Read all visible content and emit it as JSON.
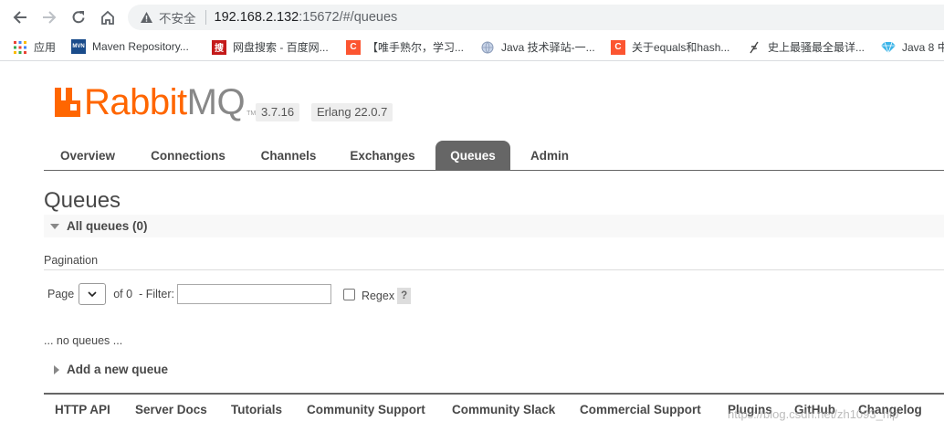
{
  "browser": {
    "insecure_label": "不安全",
    "url_host": "192.168.2.132",
    "url_path": ":15672/#/queues",
    "bookmarks": [
      {
        "label": "应用",
        "icon": "apps-grid-icon"
      },
      {
        "label": "Maven Repository...",
        "icon": "maven-icon"
      },
      {
        "label": "网盘搜索 - 百度网...",
        "icon": "sou-icon"
      },
      {
        "label": "【唯手熟尔，学习...",
        "icon": "csdn-icon"
      },
      {
        "label": "Java 技术驿站-一...",
        "icon": "globe-icon"
      },
      {
        "label": "关于equals和hash...",
        "icon": "csdn-icon"
      },
      {
        "label": "史上最骚最全最详...",
        "icon": "feather-icon"
      },
      {
        "label": "Java 8 中",
        "icon": "diamond-icon"
      }
    ]
  },
  "app": {
    "logo_main": "Rabbit",
    "logo_mq": "MQ",
    "logo_tm": "TM",
    "version": "3.7.16",
    "erlang": "Erlang 22.0.7",
    "accent": "#ff6600"
  },
  "tabs": [
    {
      "label": "Overview",
      "active": false
    },
    {
      "label": "Connections",
      "active": false
    },
    {
      "label": "Channels",
      "active": false
    },
    {
      "label": "Exchanges",
      "active": false
    },
    {
      "label": "Queues",
      "active": true
    },
    {
      "label": "Admin",
      "active": false
    }
  ],
  "page": {
    "title": "Queues",
    "section_label": "All queues (0)",
    "pagination_label": "Pagination",
    "page_label": "Page",
    "of_label": "of 0",
    "filter_label": "- Filter:",
    "filter_value": "",
    "regex_label": "Regex",
    "help_label": "?",
    "empty_text": "... no queues ...",
    "add_queue_label": "Add a new queue"
  },
  "footer": {
    "links": [
      "HTTP API",
      "Server Docs",
      "Tutorials",
      "Community Support",
      "Community Slack",
      "Commercial Support",
      "Plugins",
      "GitHub",
      "Changelog"
    ]
  },
  "watermark": "https://blog.csdn.net/zh1093_hlp"
}
